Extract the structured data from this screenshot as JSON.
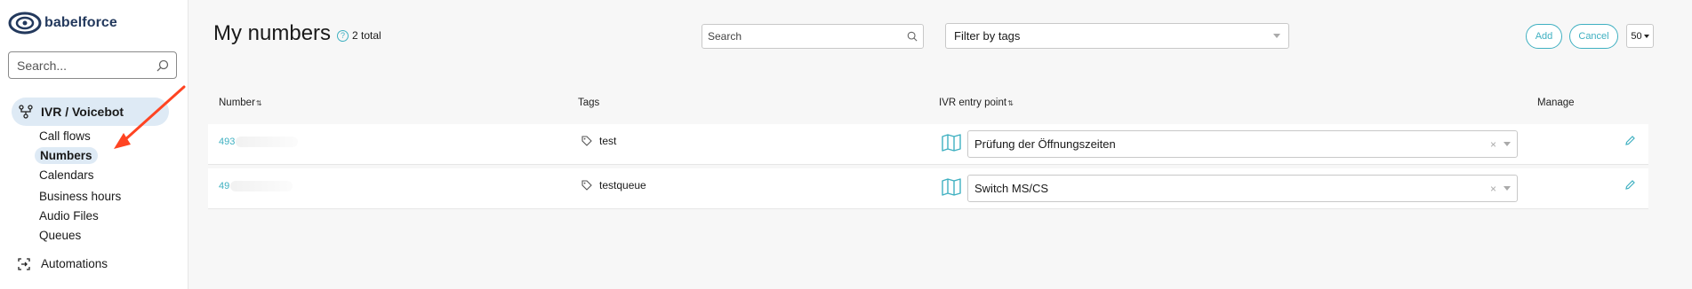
{
  "app": {
    "logo_text": "babelforce"
  },
  "sidebar": {
    "search_placeholder": "Search...",
    "active_section": {
      "label": "IVR / Voicebot"
    },
    "sub_items": [
      {
        "label": "Call flows"
      },
      {
        "label": "Numbers",
        "active": true
      },
      {
        "label": "Calendars"
      },
      {
        "label": "Business hours"
      },
      {
        "label": "Audio Files"
      },
      {
        "label": "Queues"
      }
    ],
    "automations": {
      "label": "Automations"
    }
  },
  "page": {
    "title": "My numbers",
    "total_label": "2 total",
    "search_placeholder": "Search",
    "tag_filter_label": "Filter by tags",
    "add_label": "Add",
    "cancel_label": "Cancel",
    "per_page": "50"
  },
  "table": {
    "headers": {
      "number": "Number",
      "tags": "Tags",
      "ivr": "IVR entry point",
      "manage": "Manage"
    },
    "rows": [
      {
        "number": "493",
        "tag": "test",
        "ivr": "Prüfung der Öffnungszeiten"
      },
      {
        "number": "49",
        "tag": "testqueue",
        "ivr": "Switch MS/CS"
      }
    ]
  },
  "colors": {
    "accent": "#3fb0c1",
    "active_bg": "#deeaf5",
    "brand": "#23395d",
    "annotation_arrow": "#ff4422"
  }
}
